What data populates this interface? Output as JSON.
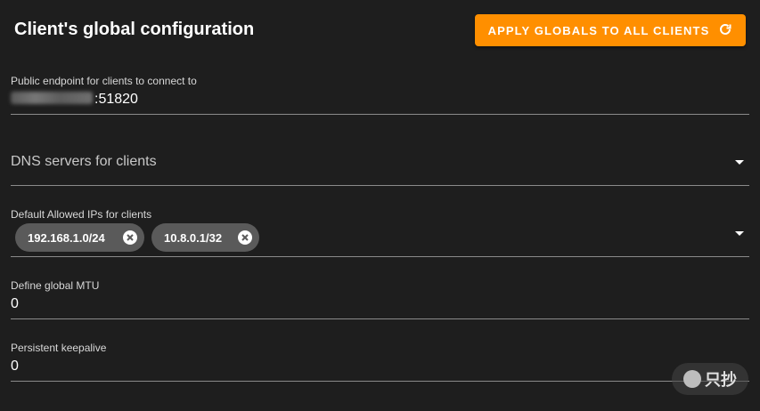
{
  "header": {
    "title": "Client's global configuration",
    "apply_button": "APPLY GLOBALS TO ALL CLIENTS",
    "apply_icon": "refresh-icon",
    "accent_color": "#ff8f00"
  },
  "endpoint": {
    "label": "Public endpoint for clients to connect to",
    "port_suffix": ":51820"
  },
  "dns": {
    "placeholder": "DNS servers for clients",
    "icon": "dropdown-arrow-icon"
  },
  "allowed_ips": {
    "label": "Default Allowed IPs for clients",
    "chips": [
      "192.168.1.0/24",
      "10.8.0.1/32"
    ],
    "chip_remove_icon": "close-circle-icon"
  },
  "mtu": {
    "label": "Define global MTU",
    "value": "0"
  },
  "keepalive": {
    "label": "Persistent keepalive",
    "value": "0"
  },
  "watermark": {
    "text": "只抄"
  }
}
